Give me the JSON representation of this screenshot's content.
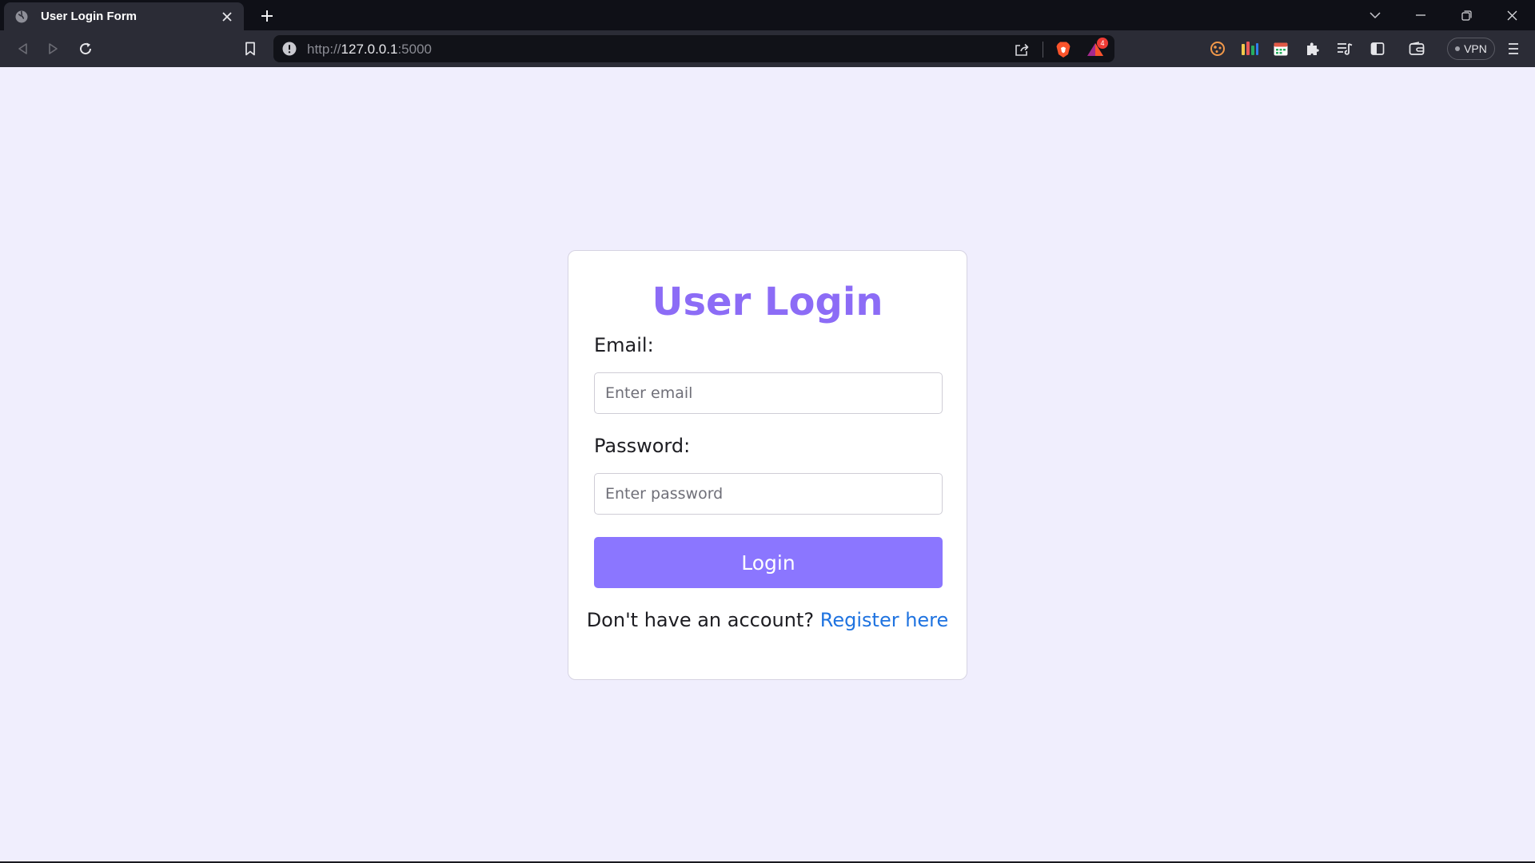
{
  "browser": {
    "tab": {
      "title": "User Login Form"
    },
    "address": {
      "scheme": "http://",
      "host": "127.0.0.1",
      "port": ":5000"
    },
    "shields_badge": "4",
    "vpn_label": "VPN",
    "colors": {
      "chrome_dark": "#0f1017",
      "chrome_toolbar": "#2b2c36",
      "omnibox": "#111218"
    }
  },
  "page": {
    "title": "User Login",
    "email": {
      "label": "Email:",
      "placeholder": "Enter email",
      "value": ""
    },
    "password": {
      "label": "Password:",
      "placeholder": "Enter password",
      "value": ""
    },
    "login_button": "Login",
    "register": {
      "prompt": "Don't have an account?",
      "link_text": "Register here"
    },
    "colors": {
      "background": "#f0eefd",
      "accent": "#8c6cf6",
      "button": "#8b76ff",
      "link": "#1f73e0"
    }
  }
}
